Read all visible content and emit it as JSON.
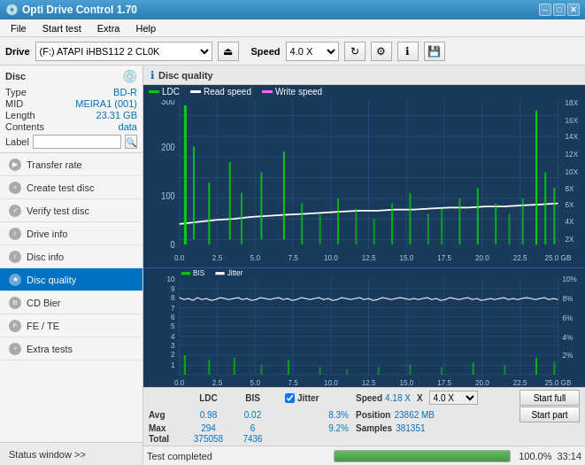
{
  "titlebar": {
    "title": "Opti Drive Control 1.70",
    "icon": "💿",
    "min_btn": "─",
    "max_btn": "□",
    "close_btn": "✕"
  },
  "menubar": {
    "items": [
      "File",
      "Start test",
      "Extra",
      "Help"
    ]
  },
  "toolbar": {
    "drive_label": "Drive",
    "drive_value": "(F:)  ATAPI iHBS112  2 CL0K",
    "speed_label": "Speed",
    "speed_value": "4.0 X"
  },
  "disc": {
    "type_label": "Type",
    "type_value": "BD-R",
    "mid_label": "MID",
    "mid_value": "MEIRA1 (001)",
    "length_label": "Length",
    "length_value": "23.31 GB",
    "contents_label": "Contents",
    "contents_value": "data",
    "label_label": "Label",
    "label_placeholder": ""
  },
  "sidebar": {
    "items": [
      {
        "id": "transfer-rate",
        "label": "Transfer rate",
        "active": false
      },
      {
        "id": "create-test-disc",
        "label": "Create test disc",
        "active": false
      },
      {
        "id": "verify-test-disc",
        "label": "Verify test disc",
        "active": false
      },
      {
        "id": "drive-info",
        "label": "Drive info",
        "active": false
      },
      {
        "id": "disc-info",
        "label": "Disc info",
        "active": false
      },
      {
        "id": "disc-quality",
        "label": "Disc quality",
        "active": true
      },
      {
        "id": "cd-bier",
        "label": "CD Bier",
        "active": false
      },
      {
        "id": "fe-te",
        "label": "FE / TE",
        "active": false
      },
      {
        "id": "extra-tests",
        "label": "Extra tests",
        "active": false
      }
    ],
    "status_window": "Status window >>"
  },
  "chart": {
    "title": "Disc quality",
    "icon": "ℹ",
    "legend": {
      "ldc": "LDC",
      "read": "Read speed",
      "write": "Write speed"
    },
    "upper": {
      "y_max": 300,
      "y_labels": [
        "300",
        "200",
        "100",
        "0"
      ],
      "y_right": [
        "18X",
        "16X",
        "14X",
        "12X",
        "10X",
        "8X",
        "6X",
        "4X",
        "2X"
      ],
      "x_labels": [
        "0.0",
        "2.5",
        "5.0",
        "7.5",
        "10.0",
        "12.5",
        "15.0",
        "17.5",
        "20.0",
        "22.5",
        "25.0 GB"
      ]
    },
    "lower": {
      "title_ldc": "BIS",
      "title_jitter": "Jitter",
      "y_labels": [
        "10",
        "9",
        "8",
        "7",
        "6",
        "5",
        "4",
        "3",
        "2",
        "1"
      ],
      "y_right_pct": [
        "10%",
        "8%",
        "6%",
        "4%",
        "2%"
      ],
      "x_labels": [
        "0.0",
        "2.5",
        "5.0",
        "7.5",
        "10.0",
        "12.5",
        "15.0",
        "17.5",
        "20.0",
        "22.5",
        "25.0 GB"
      ]
    }
  },
  "stats": {
    "headers": [
      "",
      "LDC",
      "BIS",
      "",
      "Jitter",
      "Speed",
      "",
      ""
    ],
    "avg_label": "Avg",
    "avg_ldc": "0.98",
    "avg_bis": "0.02",
    "avg_jitter": "8.3%",
    "avg_speed_label": "Speed",
    "avg_speed_val": "4.18 X",
    "speed_select": "4.0 X",
    "max_label": "Max",
    "max_ldc": "294",
    "max_bis": "6",
    "max_jitter": "9.2%",
    "pos_label": "Position",
    "pos_val": "23862 MB",
    "total_label": "Total",
    "total_ldc": "375058",
    "total_bis": "7436",
    "samples_label": "Samples",
    "samples_val": "381351",
    "start_full_label": "Start full",
    "start_part_label": "Start part",
    "jitter_checked": true,
    "jitter_label": "Jitter"
  },
  "statusbar": {
    "text": "Test completed",
    "progress_pct": 100,
    "progress_text": "100.0%",
    "time": "33:14"
  }
}
